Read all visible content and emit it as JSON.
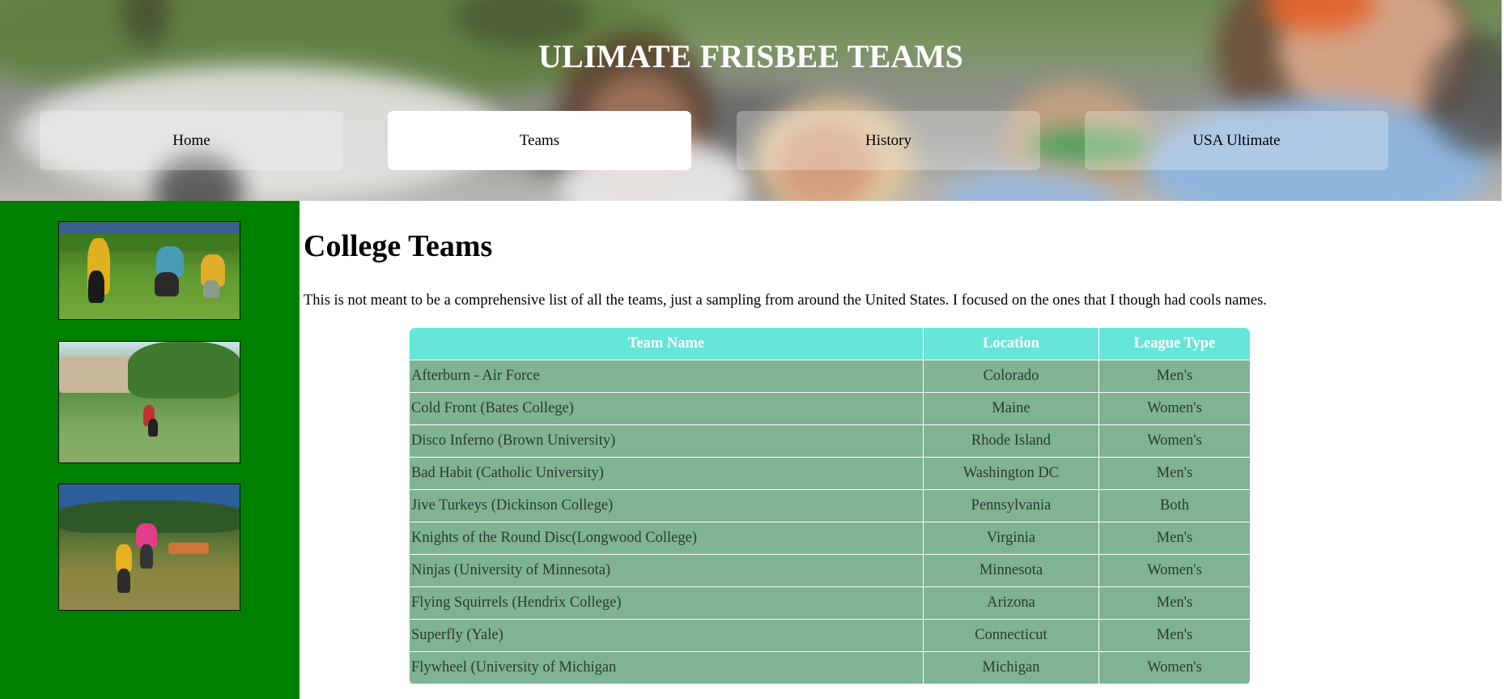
{
  "header": {
    "title": "ULIMATE FRISBEE TEAMS"
  },
  "nav": {
    "items": [
      {
        "label": "Home",
        "active": false
      },
      {
        "label": "Teams",
        "active": true
      },
      {
        "label": "History",
        "active": false
      },
      {
        "label": "USA Ultimate",
        "active": false
      }
    ]
  },
  "main": {
    "heading": "College Teams",
    "intro": "This is not meant to be a comprehensive list of all the teams, just a sampling from around the United States. I focused on the ones that I though had cools names."
  },
  "table": {
    "headers": [
      "Team Name",
      "Location",
      "League Type"
    ],
    "rows": [
      [
        "Afterburn - Air Force",
        "Colorado",
        "Men's"
      ],
      [
        "Cold Front (Bates College)",
        "Maine",
        "Women's"
      ],
      [
        "Disco Inferno (Brown University)",
        "Rhode Island",
        "Women's"
      ],
      [
        "Bad Habit (Catholic University)",
        "Washington DC",
        "Men's"
      ],
      [
        "Jive Turkeys (Dickinson College)",
        "Pennsylvania",
        "Both"
      ],
      [
        "Knights of the Round Disc(Longwood College)",
        "Virginia",
        "Men's"
      ],
      [
        "Ninjas (University of Minnesota)",
        "Minnesota",
        "Women's"
      ],
      [
        "Flying Squirrels (Hendrix College)",
        "Arizona",
        "Men's"
      ],
      [
        "Superfly (Yale)",
        "Connecticut",
        "Men's"
      ],
      [
        "Flywheel (University of Michigan",
        "Michigan",
        "Women's"
      ]
    ]
  },
  "colors": {
    "sidebar": "#008000",
    "table_header": "#66e6d8",
    "table_row": "#80b391"
  }
}
